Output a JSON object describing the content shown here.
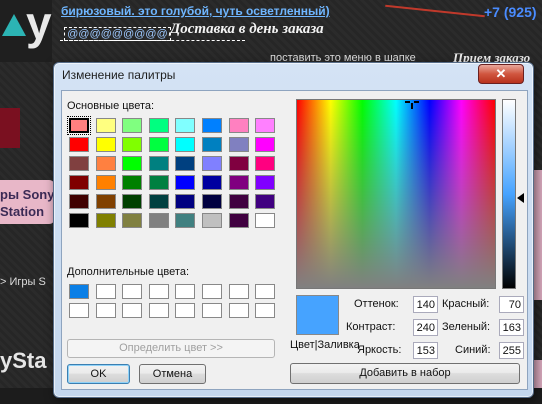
{
  "background": {
    "logo_letter": "y",
    "top_text": "бирюзовый. это голубой, чуть осветленный)",
    "phone": "+7 (925)",
    "email": "@@@@@@@@@",
    "delivery": "Доставка в день заказа",
    "menu_note": "поставить это меню в шапке",
    "priem": "Прием заказо",
    "sony_line1": "ры Sony",
    "sony_line2": "Station",
    "breadcrumb": "> Игры S",
    "brand": "ySta"
  },
  "dialog": {
    "title": "Изменение палитры",
    "close_glyph": "✕",
    "basic_colors_label": "Основные цвета:",
    "custom_colors_label": "Дополнительные цвета:",
    "define_button": "Определить цвет >>",
    "ok_button": "OK",
    "cancel_button": "Отмена",
    "add_button": "Добавить в набор",
    "color_solid_label": "Цвет|Заливка",
    "hue_label": "Оттенок:",
    "hue_value": "140",
    "sat_label": "Контраст:",
    "sat_value": "240",
    "lum_label": "Яркость:",
    "lum_value": "153",
    "red_label": "Красный:",
    "red_value": "70",
    "green_label": "Зеленый:",
    "green_value": "163",
    "blue_label": "Синий:",
    "blue_value": "255",
    "preview_color": "#46a3ff",
    "basic_colors": [
      "#ff8080",
      "#ffff80",
      "#80ff80",
      "#00ff80",
      "#80ffff",
      "#0080ff",
      "#ff80c0",
      "#ff80ff",
      "#ff0000",
      "#ffff00",
      "#80ff00",
      "#00ff40",
      "#00ffff",
      "#0080c0",
      "#8080c0",
      "#ff00ff",
      "#804040",
      "#ff8040",
      "#00ff00",
      "#008080",
      "#004080",
      "#8080ff",
      "#800040",
      "#ff0080",
      "#800000",
      "#ff8000",
      "#008000",
      "#008040",
      "#0000ff",
      "#0000a0",
      "#800080",
      "#8000ff",
      "#400000",
      "#804000",
      "#004000",
      "#004040",
      "#000080",
      "#000040",
      "#400040",
      "#400080",
      "#000000",
      "#808000",
      "#808040",
      "#808080",
      "#408080",
      "#c0c0c0",
      "#400040",
      "#ffffff"
    ],
    "selected_basic_index": 0,
    "custom_colors": [
      "#0a7fe6",
      "#ffffff",
      "#ffffff",
      "#ffffff",
      "#ffffff",
      "#ffffff",
      "#ffffff",
      "#ffffff",
      "#ffffff",
      "#ffffff",
      "#ffffff",
      "#ffffff",
      "#ffffff",
      "#ffffff",
      "#ffffff",
      "#ffffff"
    ]
  }
}
